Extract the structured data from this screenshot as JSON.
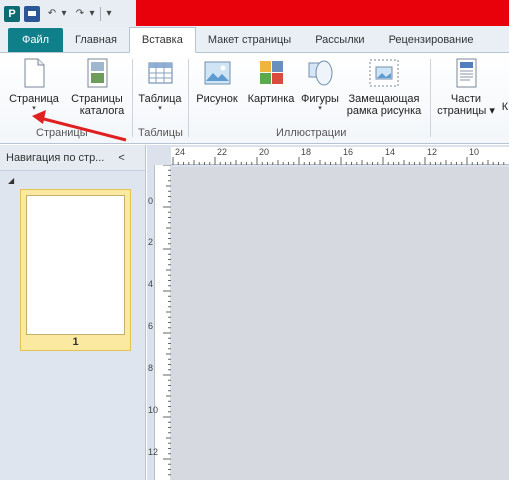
{
  "quick_access": {
    "app_icon_letter": "P",
    "undo_glyph": "↶",
    "redo_glyph": "↷",
    "more_glyph": "▾"
  },
  "tabs": [
    {
      "label": "Файл"
    },
    {
      "label": "Главная"
    },
    {
      "label": "Вставка"
    },
    {
      "label": "Макет страницы"
    },
    {
      "label": "Рассылки"
    },
    {
      "label": "Рецензирование"
    }
  ],
  "ribbon": {
    "buttons": {
      "page": {
        "label": "Страница",
        "arrow": "▾"
      },
      "catalog": {
        "label_line1": "Страницы",
        "label_line2": "каталога"
      },
      "table": {
        "label": "Таблица",
        "arrow": "▾"
      },
      "picture": {
        "label": "Рисунок"
      },
      "clipart": {
        "label": "Картинка"
      },
      "shapes": {
        "label": "Фигуры",
        "arrow": "▾"
      },
      "placeholder": {
        "label_line1": "Замещающая",
        "label_line2": "рамка рисунка"
      },
      "parts": {
        "label_line1": "Части",
        "label_line2": "страницы ▾"
      },
      "next_letter": {
        "label": "К"
      }
    },
    "groups": {
      "pages": "Страницы",
      "tables": "Таблицы",
      "illustrations": "Иллюстрации"
    }
  },
  "nav_pane": {
    "title": "Навигация по стр...",
    "close_glyph": "<",
    "collapse_glyph": "◢",
    "page_number": "1"
  },
  "hruler": [
    "24",
    "22",
    "20",
    "18",
    "16",
    "14",
    "12",
    "10"
  ],
  "vruler": [
    "0",
    "2",
    "4",
    "6",
    "8",
    "10",
    "12"
  ],
  "colors": {
    "accent_red": "#e8000a",
    "file_tab": "#0f7f8a",
    "thumb_highlight": "#fbe9a2",
    "arrow": "#e02020"
  }
}
